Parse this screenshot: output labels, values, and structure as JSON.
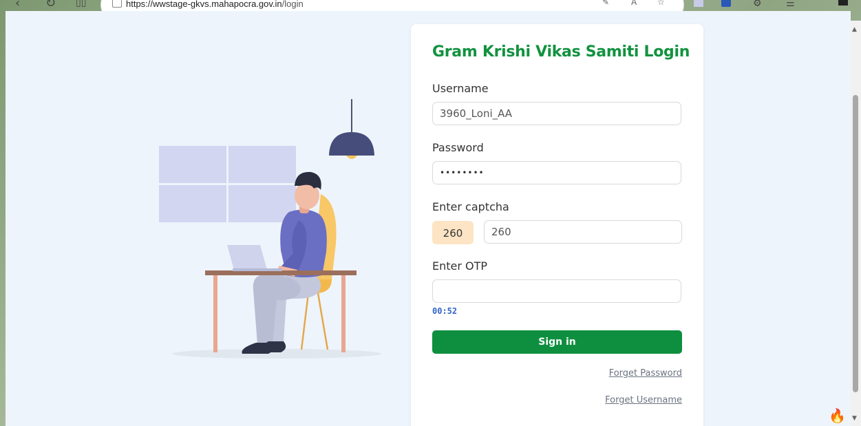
{
  "browser": {
    "url_host": "https://wwstage-gkvs.mahapocra.gov.in",
    "url_path": "/login"
  },
  "login": {
    "title": "Gram Krishi Vikas Samiti Login",
    "username_label": "Username",
    "username_value": "3960_Loni_AA",
    "password_label": "Password",
    "password_value": "••••••••",
    "captcha_label": "Enter captcha",
    "captcha_code": "260",
    "captcha_value": "260",
    "otp_label": "Enter OTP",
    "otp_value": "",
    "otp_timer": "00:52",
    "signin_label": "Sign in",
    "forget_password": "Forget Password",
    "forget_username": "Forget Username"
  },
  "colors": {
    "brand_green": "#12923f",
    "button_green": "#0e8f3f",
    "captcha_bg": "#fde4c4",
    "timer_blue": "#2f63c9",
    "page_bg": "#eef4fc"
  }
}
